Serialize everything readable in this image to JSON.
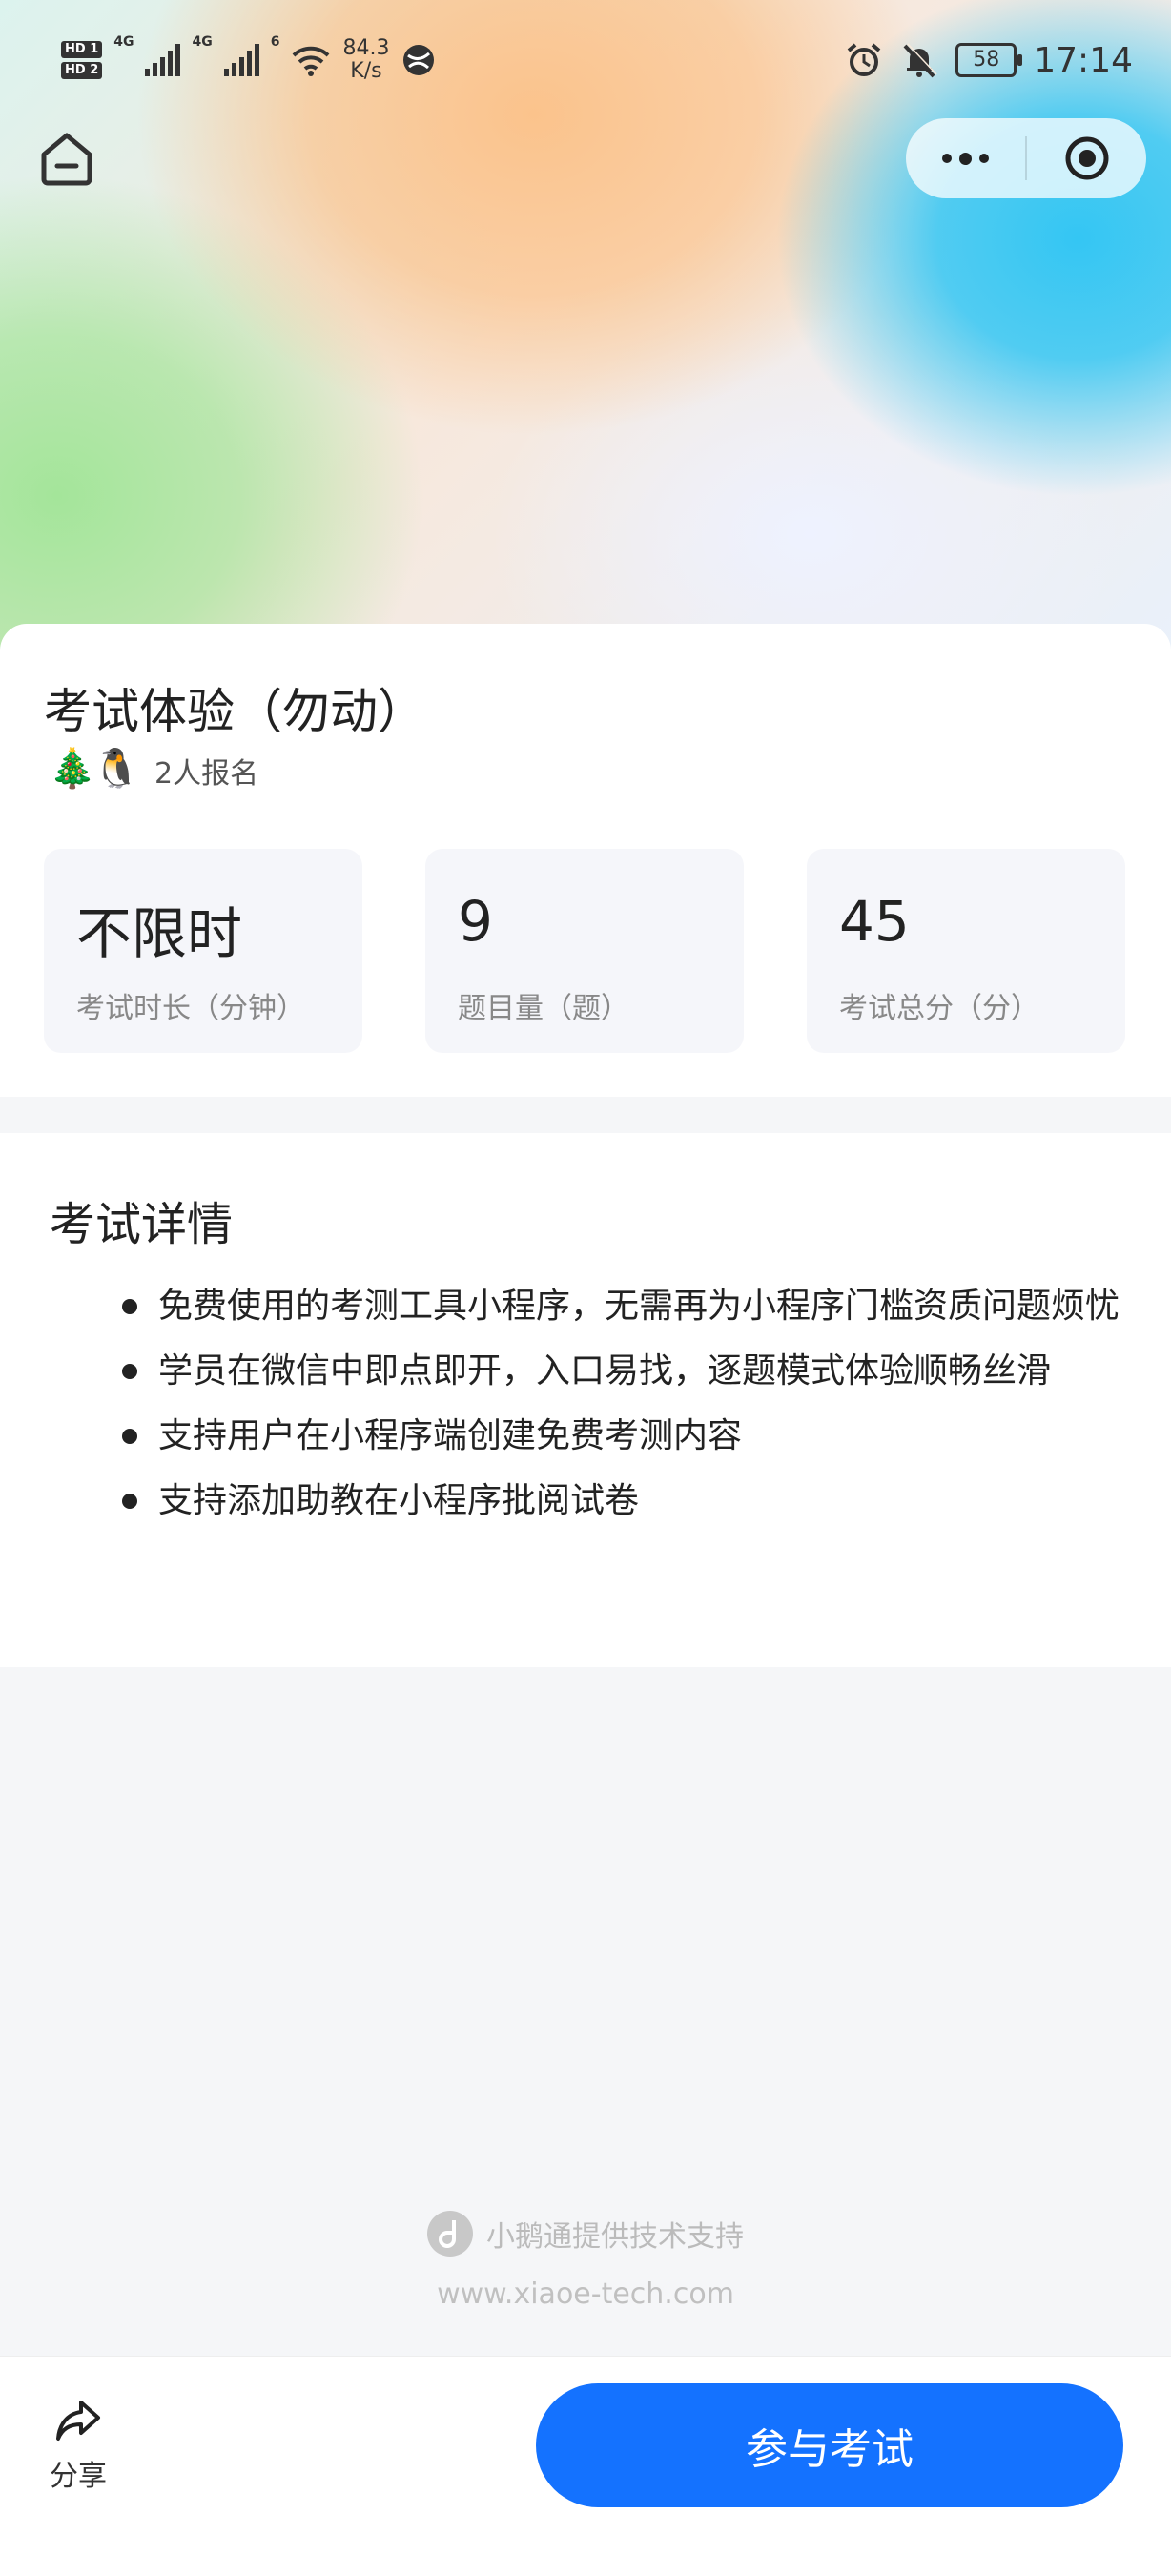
{
  "status_bar": {
    "hd1": "HD 1",
    "hd2": "HD 2",
    "net1": "4G",
    "net2": "4G",
    "wifi": "6",
    "speed_value": "84.3",
    "speed_unit": "K/s",
    "battery": "58",
    "time": "17:14"
  },
  "exam": {
    "title": "考试体验（勿动）",
    "enroll_text": "2人报名",
    "stats": [
      {
        "value": "不限时",
        "label": "考试时长（分钟）"
      },
      {
        "value": "9",
        "label": "题目量（题）"
      },
      {
        "value": "45",
        "label": "考试总分（分）"
      }
    ]
  },
  "details": {
    "title": "考试详情",
    "items": [
      "免费使用的考测工具小程序，无需再为小程序门槛资质问题烦忧",
      "学员在微信中即点即开，入口易找，逐题模式体验顺畅丝滑",
      "支持用户在小程序端创建免费考测内容",
      "支持添加助教在小程序批阅试卷"
    ]
  },
  "footer": {
    "powered_by": "小鹅通提供技术支持",
    "site": "www.xiaoe-tech.com"
  },
  "bottom_bar": {
    "share_label": "分享",
    "join_label": "参与考试"
  },
  "colors": {
    "primary": "#1472ff"
  }
}
